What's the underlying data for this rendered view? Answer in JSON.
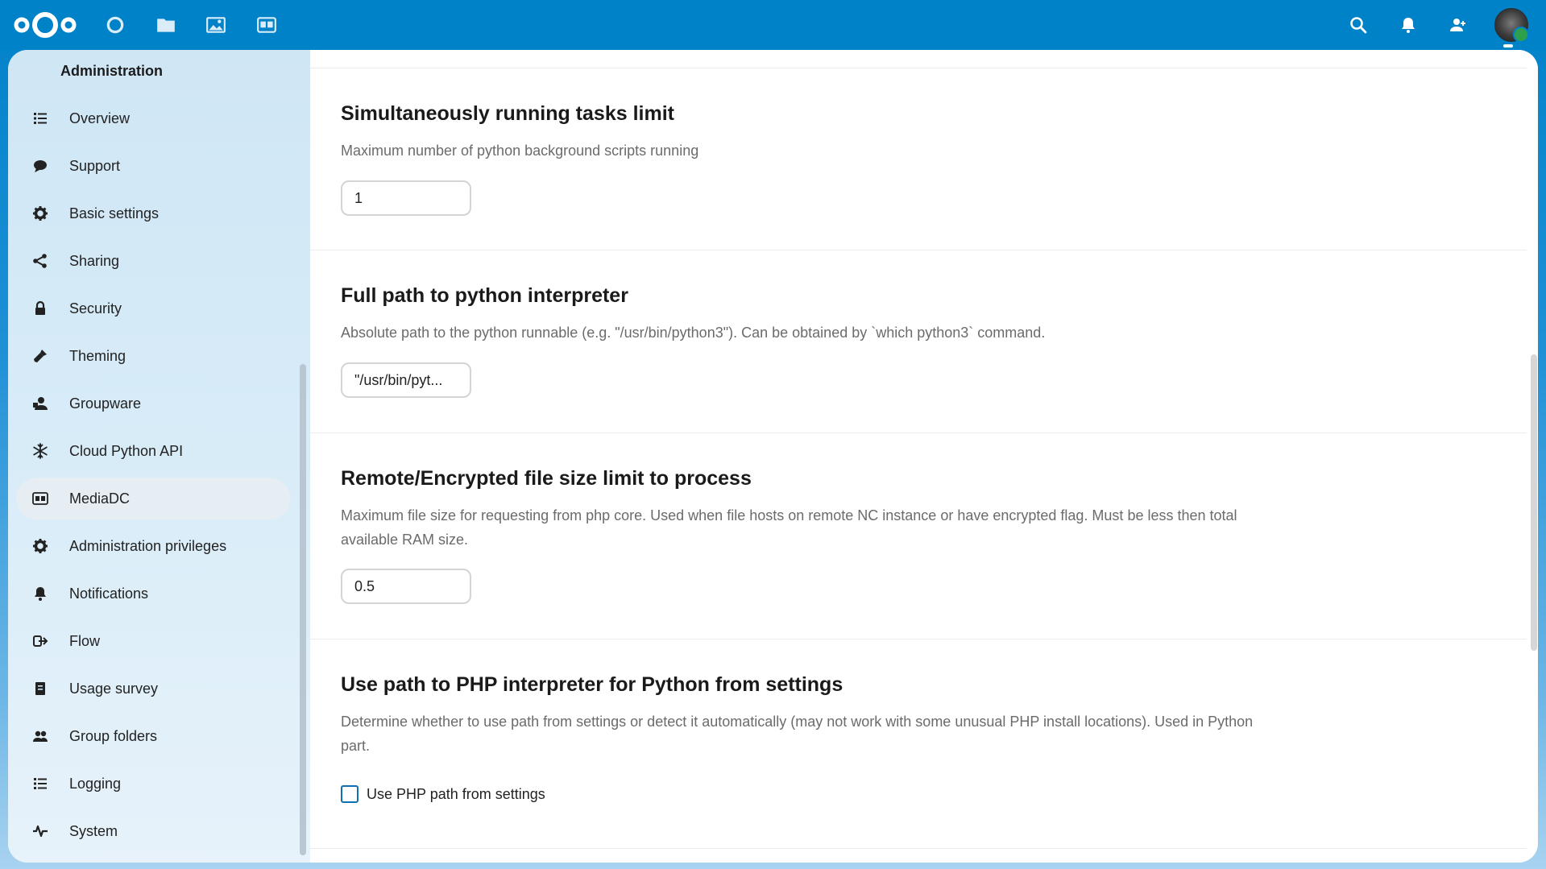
{
  "header": {
    "apps": [
      {
        "name": "dashboard-icon"
      },
      {
        "name": "files-icon"
      },
      {
        "name": "photos-icon"
      },
      {
        "name": "mediadc-icon"
      }
    ],
    "right": [
      {
        "name": "search-icon"
      },
      {
        "name": "notifications-icon"
      },
      {
        "name": "contacts-icon"
      }
    ],
    "brand_color": "#0082c9"
  },
  "sidebar": {
    "title": "Administration",
    "items": [
      {
        "label": "Overview",
        "icon": "list-icon"
      },
      {
        "label": "Support",
        "icon": "chat-icon"
      },
      {
        "label": "Basic settings",
        "icon": "gear-icon"
      },
      {
        "label": "Sharing",
        "icon": "share-icon"
      },
      {
        "label": "Security",
        "icon": "lock-icon"
      },
      {
        "label": "Theming",
        "icon": "brush-icon"
      },
      {
        "label": "Groupware",
        "icon": "groupware-icon"
      },
      {
        "label": "Cloud Python API",
        "icon": "snowflake-icon"
      },
      {
        "label": "MediaDC",
        "icon": "mediadc-icon",
        "active": true
      },
      {
        "label": "Administration privileges",
        "icon": "gear-icon"
      },
      {
        "label": "Notifications",
        "icon": "bell-icon"
      },
      {
        "label": "Flow",
        "icon": "flow-icon"
      },
      {
        "label": "Usage survey",
        "icon": "survey-icon"
      },
      {
        "label": "Group folders",
        "icon": "group-icon"
      },
      {
        "label": "Logging",
        "icon": "list-icon"
      },
      {
        "label": "System",
        "icon": "pulse-icon"
      }
    ]
  },
  "main": {
    "tasks_limit": {
      "title": "Simultaneously running tasks limit",
      "desc": "Maximum number of python background scripts running",
      "value": "1"
    },
    "python_path": {
      "title": "Full path to python interpreter",
      "desc": "Absolute path to the python runnable (e.g. \"/usr/bin/python3\"). Can be obtained by `which python3` command.",
      "value": "\"/usr/bin/pyt..."
    },
    "file_size": {
      "title": "Remote/Encrypted file size limit to process",
      "desc": "Maximum file size for requesting from php core. Used when file hosts on remote NC instance or have encrypted flag. Must be less then total available RAM size.",
      "value": "0.5"
    },
    "php_path": {
      "title": "Use path to PHP interpreter for Python from settings",
      "desc": "Determine whether to use path from settings or detect it automatically (may not work with some unusual PHP install locations). Used in Python part.",
      "checkbox_label": "Use PHP path from settings",
      "checked": false
    }
  }
}
